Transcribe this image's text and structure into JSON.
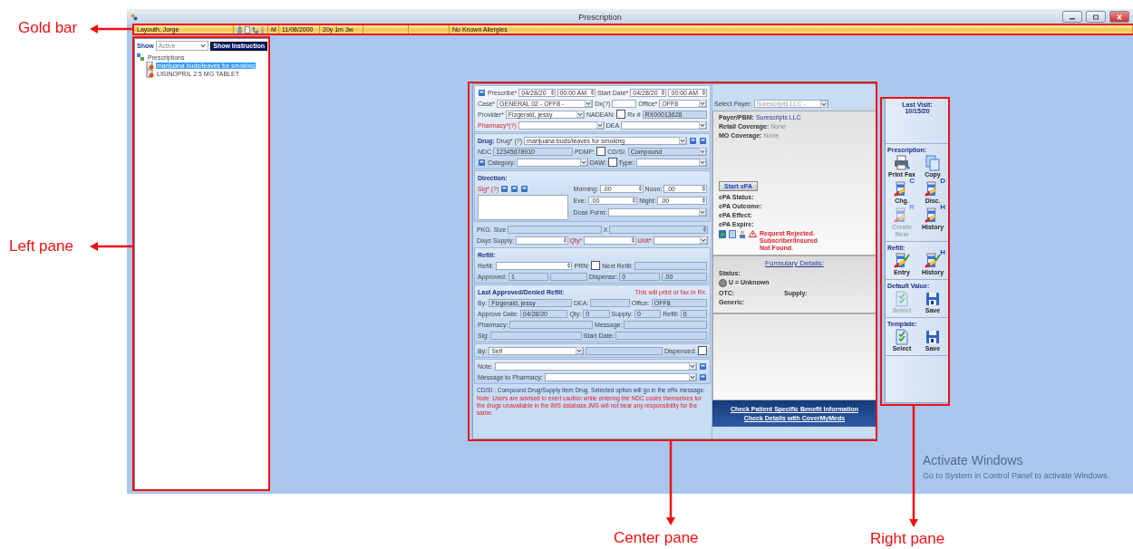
{
  "window": {
    "title": "Prescription"
  },
  "gold_bar": {
    "patient": "Layouth, Jorge",
    "sex": "M",
    "dob": "11/08/2000",
    "age": "20y 1m 3w",
    "allergies": "No Known Allergies"
  },
  "left_pane": {
    "show_label": "Show",
    "show_filter": "Active",
    "instruction_button": "Show Instruction",
    "tree": [
      {
        "label": "Prescriptions",
        "selected": false,
        "children": [
          {
            "label": "marijuana buds/leaves for smoking",
            "selected": true
          },
          {
            "label": "LISINOPRIL 2.5 MG TABLET",
            "selected": false
          }
        ]
      }
    ]
  },
  "prescription_form": {
    "sections": [
      {
        "kind": "top",
        "rows": [
          {
            "items": [
              {
                "kind": "icon"
              },
              {
                "kind": "label",
                "text": "Prescribe*"
              },
              {
                "kind": "spin",
                "value": "04/28/20"
              },
              {
                "kind": "spin",
                "value": "00:00 AM"
              },
              {
                "kind": "label",
                "text": "Start Date*"
              },
              {
                "kind": "spin",
                "value": "04/28/20"
              },
              {
                "kind": "spin",
                "value": "00:00 AM"
              }
            ]
          },
          {
            "items": [
              {
                "kind": "label",
                "text": "Case*"
              },
              {
                "kind": "select",
                "value": "GENERAL 02 - OFF8 -"
              },
              {
                "kind": "label",
                "text": "Dx(?)"
              },
              {
                "kind": "input"
              },
              {
                "kind": "label",
                "text": "Office*"
              },
              {
                "kind": "select",
                "value": "OFF8"
              }
            ]
          },
          {
            "items": [
              {
                "kind": "label",
                "text": "Provider*"
              },
              {
                "kind": "select",
                "value": "Fizgerald, jessy"
              },
              {
                "kind": "label",
                "text": "NADEAN:"
              },
              {
                "kind": "check",
                "checked": false
              },
              {
                "kind": "label",
                "text": "Rx #"
              },
              {
                "kind": "input",
                "value": "RX00013628",
                "readonly": true
              }
            ]
          },
          {
            "items": [
              {
                "kind": "label",
                "text": "Pharmacy*(?)",
                "required": true
              },
              {
                "kind": "select"
              },
              {
                "kind": "label",
                "text": "DEA"
              },
              {
                "kind": "select"
              }
            ]
          }
        ]
      },
      {
        "kind": "panel",
        "rows": [
          {
            "items": [
              {
                "kind": "heading",
                "text": "Drug:"
              },
              {
                "kind": "label",
                "text": "Drug* (?)"
              },
              {
                "kind": "select",
                "value": "marijuana buds/leaves for smoking"
              },
              {
                "kind": "icon"
              },
              {
                "kind": "icon"
              }
            ]
          },
          {
            "items": [
              {
                "kind": "label",
                "text": "NDC"
              },
              {
                "kind": "input",
                "value": "12345678910",
                "readonly": true
              },
              {
                "kind": "label",
                "text": "PDMP:"
              },
              {
                "kind": "check",
                "checked": false
              },
              {
                "kind": "label",
                "text": "CD/SI:"
              },
              {
                "kind": "select",
                "value": "Compound",
                "readonly": true
              }
            ]
          },
          {
            "items": [
              {
                "kind": "icon"
              },
              {
                "kind": "label",
                "text": "Category:"
              },
              {
                "kind": "select"
              },
              {
                "kind": "label",
                "text": "DAW:"
              },
              {
                "kind": "check",
                "checked": false
              },
              {
                "kind": "label",
                "text": "Type:"
              },
              {
                "kind": "select"
              }
            ]
          }
        ]
      },
      {
        "kind": "direction",
        "rows": [
          {
            "items": [
              {
                "kind": "heading",
                "text": "Direction:"
              }
            ]
          }
        ],
        "left": [
          {
            "items": [
              {
                "kind": "label",
                "text": "Sig* (?)",
                "required": true
              },
              {
                "kind": "icon"
              },
              {
                "kind": "icon"
              },
              {
                "kind": "icon"
              }
            ]
          },
          {
            "items": [
              {
                "kind": "textarea"
              }
            ]
          }
        ],
        "right": [
          {
            "items": [
              {
                "kind": "label",
                "text": "Morning:"
              },
              {
                "kind": "spin",
                "value": ".00"
              },
              {
                "kind": "label",
                "text": "Noon:"
              },
              {
                "kind": "spin",
                "value": ".00"
              }
            ]
          },
          {
            "items": [
              {
                "kind": "label",
                "text": "Eve:"
              },
              {
                "kind": "spin",
                "value": ".00"
              },
              {
                "kind": "label",
                "text": "Night:"
              },
              {
                "kind": "spin",
                "value": ".00"
              }
            ]
          },
          {
            "items": [
              {
                "kind": "label",
                "text": "Dose Form:"
              },
              {
                "kind": "select"
              }
            ]
          }
        ]
      },
      {
        "kind": "plain",
        "rows": [
          {
            "items": [
              {
                "kind": "label",
                "text": "PKG. Size"
              },
              {
                "kind": "input",
                "readonly": true
              },
              {
                "kind": "label",
                "text": "X"
              },
              {
                "kind": "spin",
                "readonly": true
              }
            ]
          },
          {
            "items": [
              {
                "kind": "label",
                "text": "Days Supply:"
              },
              {
                "kind": "spin"
              },
              {
                "kind": "label",
                "text": "Qty*",
                "required": true
              },
              {
                "kind": "spin"
              },
              {
                "kind": "label",
                "text": "Unit*",
                "required": true
              },
              {
                "kind": "select"
              }
            ]
          }
        ]
      },
      {
        "kind": "panel",
        "rows": [
          {
            "items": [
              {
                "kind": "heading",
                "text": "Refill:"
              }
            ]
          },
          {
            "items": [
              {
                "kind": "label",
                "text": "Refill:"
              },
              {
                "kind": "spin"
              },
              {
                "kind": "label",
                "text": "PRN:"
              },
              {
                "kind": "check",
                "checked": false
              },
              {
                "kind": "label",
                "text": "Next Refill:"
              },
              {
                "kind": "input",
                "readonly": true
              }
            ]
          },
          {
            "items": [
              {
                "kind": "label",
                "text": "Approved:"
              },
              {
                "kind": "input",
                "value": "1",
                "readonly": true
              },
              {
                "kind": "input",
                "readonly": true
              },
              {
                "kind": "label",
                "text": "Dispense:"
              },
              {
                "kind": "input",
                "value": "0",
                "readonly": true
              },
              {
                "kind": "input",
                "value": ".00",
                "readonly": true
              }
            ]
          }
        ]
      },
      {
        "kind": "panel",
        "rows": [
          {
            "items": [
              {
                "kind": "heading",
                "text": "Last Approved/Denied Refill:"
              },
              {
                "kind": "note",
                "text": "This will print or fax in Rx."
              }
            ]
          },
          {
            "items": [
              {
                "kind": "label",
                "text": "By:"
              },
              {
                "kind": "input",
                "value": "Fizgerald, jessy",
                "readonly": true
              },
              {
                "kind": "label",
                "text": "DEA:"
              },
              {
                "kind": "input",
                "readonly": true
              },
              {
                "kind": "label",
                "text": "Office:"
              },
              {
                "kind": "input",
                "value": "OFF8",
                "readonly": true
              }
            ]
          },
          {
            "items": [
              {
                "kind": "label",
                "text": "Approve Date:"
              },
              {
                "kind": "input",
                "value": "04/28/20",
                "readonly": true
              },
              {
                "kind": "label",
                "text": "Qty:"
              },
              {
                "kind": "input",
                "value": "0",
                "readonly": true
              },
              {
                "kind": "label",
                "text": "Supply:"
              },
              {
                "kind": "input",
                "value": "0",
                "readonly": true
              },
              {
                "kind": "label",
                "text": "Refill:"
              },
              {
                "kind": "input",
                "value": "0",
                "readonly": true
              }
            ]
          },
          {
            "items": [
              {
                "kind": "label",
                "text": "Pharmacy:"
              },
              {
                "kind": "input",
                "readonly": true
              },
              {
                "kind": "label",
                "text": "Message:"
              },
              {
                "kind": "input",
                "readonly": true
              }
            ]
          },
          {
            "items": [
              {
                "kind": "label",
                "text": "Sig:"
              },
              {
                "kind": "input",
                "readonly": true
              },
              {
                "kind": "label",
                "text": "Start Date:"
              },
              {
                "kind": "input",
                "readonly": true
              }
            ]
          }
        ]
      },
      {
        "kind": "panel",
        "rows": [
          {
            "items": [
              {
                "kind": "label",
                "text": "By:"
              },
              {
                "kind": "select",
                "value": "Self"
              },
              {
                "kind": "input",
                "readonly": true
              },
              {
                "kind": "label",
                "text": "Dispensed:"
              },
              {
                "kind": "check",
                "checked": false
              }
            ]
          }
        ]
      },
      {
        "kind": "panel",
        "rows": [
          {
            "items": [
              {
                "kind": "label",
                "text": "Note:"
              },
              {
                "kind": "select"
              },
              {
                "kind": "icon"
              }
            ]
          },
          {
            "items": [
              {
                "kind": "label",
                "text": "Message to Pharmacy:"
              },
              {
                "kind": "select"
              },
              {
                "kind": "icon"
              }
            ]
          }
        ]
      }
    ],
    "legend": "CD/SI : Compound Drug/Supply Item Drug. Selected option will go in the eRx message.",
    "warning": "Note: Users are advised to exert caution while entering the NDC codes themselves for the drugs unavailable in the IMS database.IMS will not bear any responsibility for the same."
  },
  "payer": {
    "label": "Select Payer:",
    "value": "Surescripts LLC -",
    "details": [
      {
        "label": "Payer/PBM:",
        "value": "Surescripts LLC",
        "accent": true
      },
      {
        "label": "Retail Coverage:",
        "value": "None"
      },
      {
        "label": "MO Coverage:",
        "value": "None"
      }
    ],
    "epa_button": "Start ePA",
    "epa_fields": [
      "ePA Status:",
      "ePA Outcome:",
      "ePA Effect:",
      "ePA Expire:"
    ],
    "alert": "Request Rejected. Subscriber/Insured Not Found.",
    "formulary": {
      "title": "Formulary Details:",
      "status_label": "Status:",
      "status": {
        "text": "U = Unknown",
        "color": "#8c8c8c"
      },
      "otc": "OTC:",
      "supply": "Supply:",
      "generic": "Generic:"
    },
    "links": [
      "Check Patient Specific Benefit Information",
      "Check Details with CoverMyMeds"
    ]
  },
  "right_pane": {
    "last_visit_label": "Last Visit:",
    "last_visit": "10/15/20",
    "groups": [
      {
        "title": "Prescription:",
        "buttons": [
          {
            "label": "Print Fax",
            "kind": "printer",
            "disabled": false
          },
          {
            "label": "Copy",
            "kind": "copy",
            "disabled": false
          },
          {
            "label": "Chg.",
            "kind": "bottle",
            "letter": "C",
            "disabled": false
          },
          {
            "label": "Disc.",
            "kind": "bottle",
            "letter": "D",
            "disabled": false
          },
          {
            "label": "Create New",
            "kind": "bottle",
            "letter": "R",
            "disabled": true
          },
          {
            "label": "History",
            "kind": "bottle",
            "letter": "H",
            "disabled": false
          }
        ]
      },
      {
        "title": "Refill:",
        "buttons": [
          {
            "label": "Entry",
            "kind": "bottle_check",
            "disabled": false
          },
          {
            "label": "History",
            "kind": "bottle_check",
            "letter": "H",
            "disabled": false
          }
        ]
      },
      {
        "title": "Default Value:",
        "buttons": [
          {
            "label": "Select",
            "kind": "doc_check",
            "disabled": true
          },
          {
            "label": "Save",
            "kind": "floppy",
            "disabled": false
          }
        ]
      },
      {
        "title": "Template:",
        "buttons": [
          {
            "label": "Select",
            "kind": "doc_check",
            "disabled": false
          },
          {
            "label": "Save",
            "kind": "floppy",
            "disabled": false
          }
        ]
      }
    ]
  },
  "os_notice": {
    "title": "Activate Windows",
    "text": "Go to System in Control Panel to activate Windows."
  },
  "annotations": [
    {
      "label": "Gold bar"
    },
    {
      "label": "Left pane"
    },
    {
      "label": "Center pane"
    },
    {
      "label": "Right pane"
    }
  ]
}
